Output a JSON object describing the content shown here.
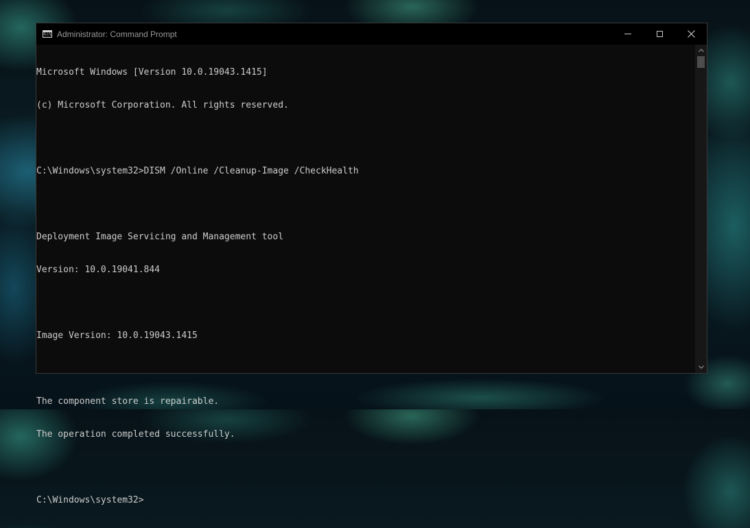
{
  "window": {
    "title": "Administrator: Command Prompt",
    "icon_label": "C:\\"
  },
  "console": {
    "lines": [
      "Microsoft Windows [Version 10.0.19043.1415]",
      "(c) Microsoft Corporation. All rights reserved.",
      "",
      "C:\\Windows\\system32>DISM /Online /Cleanup-Image /CheckHealth",
      "",
      "Deployment Image Servicing and Management tool",
      "Version: 10.0.19041.844",
      "",
      "Image Version: 10.0.19043.1415",
      "",
      "The component store is repairable.",
      "The operation completed successfully.",
      "",
      "C:\\Windows\\system32>"
    ]
  },
  "icons": {
    "app": "cmd-icon",
    "minimize": "minimize-icon",
    "maximize": "maximize-icon",
    "close": "close-icon",
    "scroll_up": "chevron-up-icon",
    "scroll_down": "chevron-down-icon"
  },
  "colors": {
    "console_bg": "#0c0c0c",
    "console_text": "#cccccc",
    "titlebar_bg": "#000000"
  }
}
